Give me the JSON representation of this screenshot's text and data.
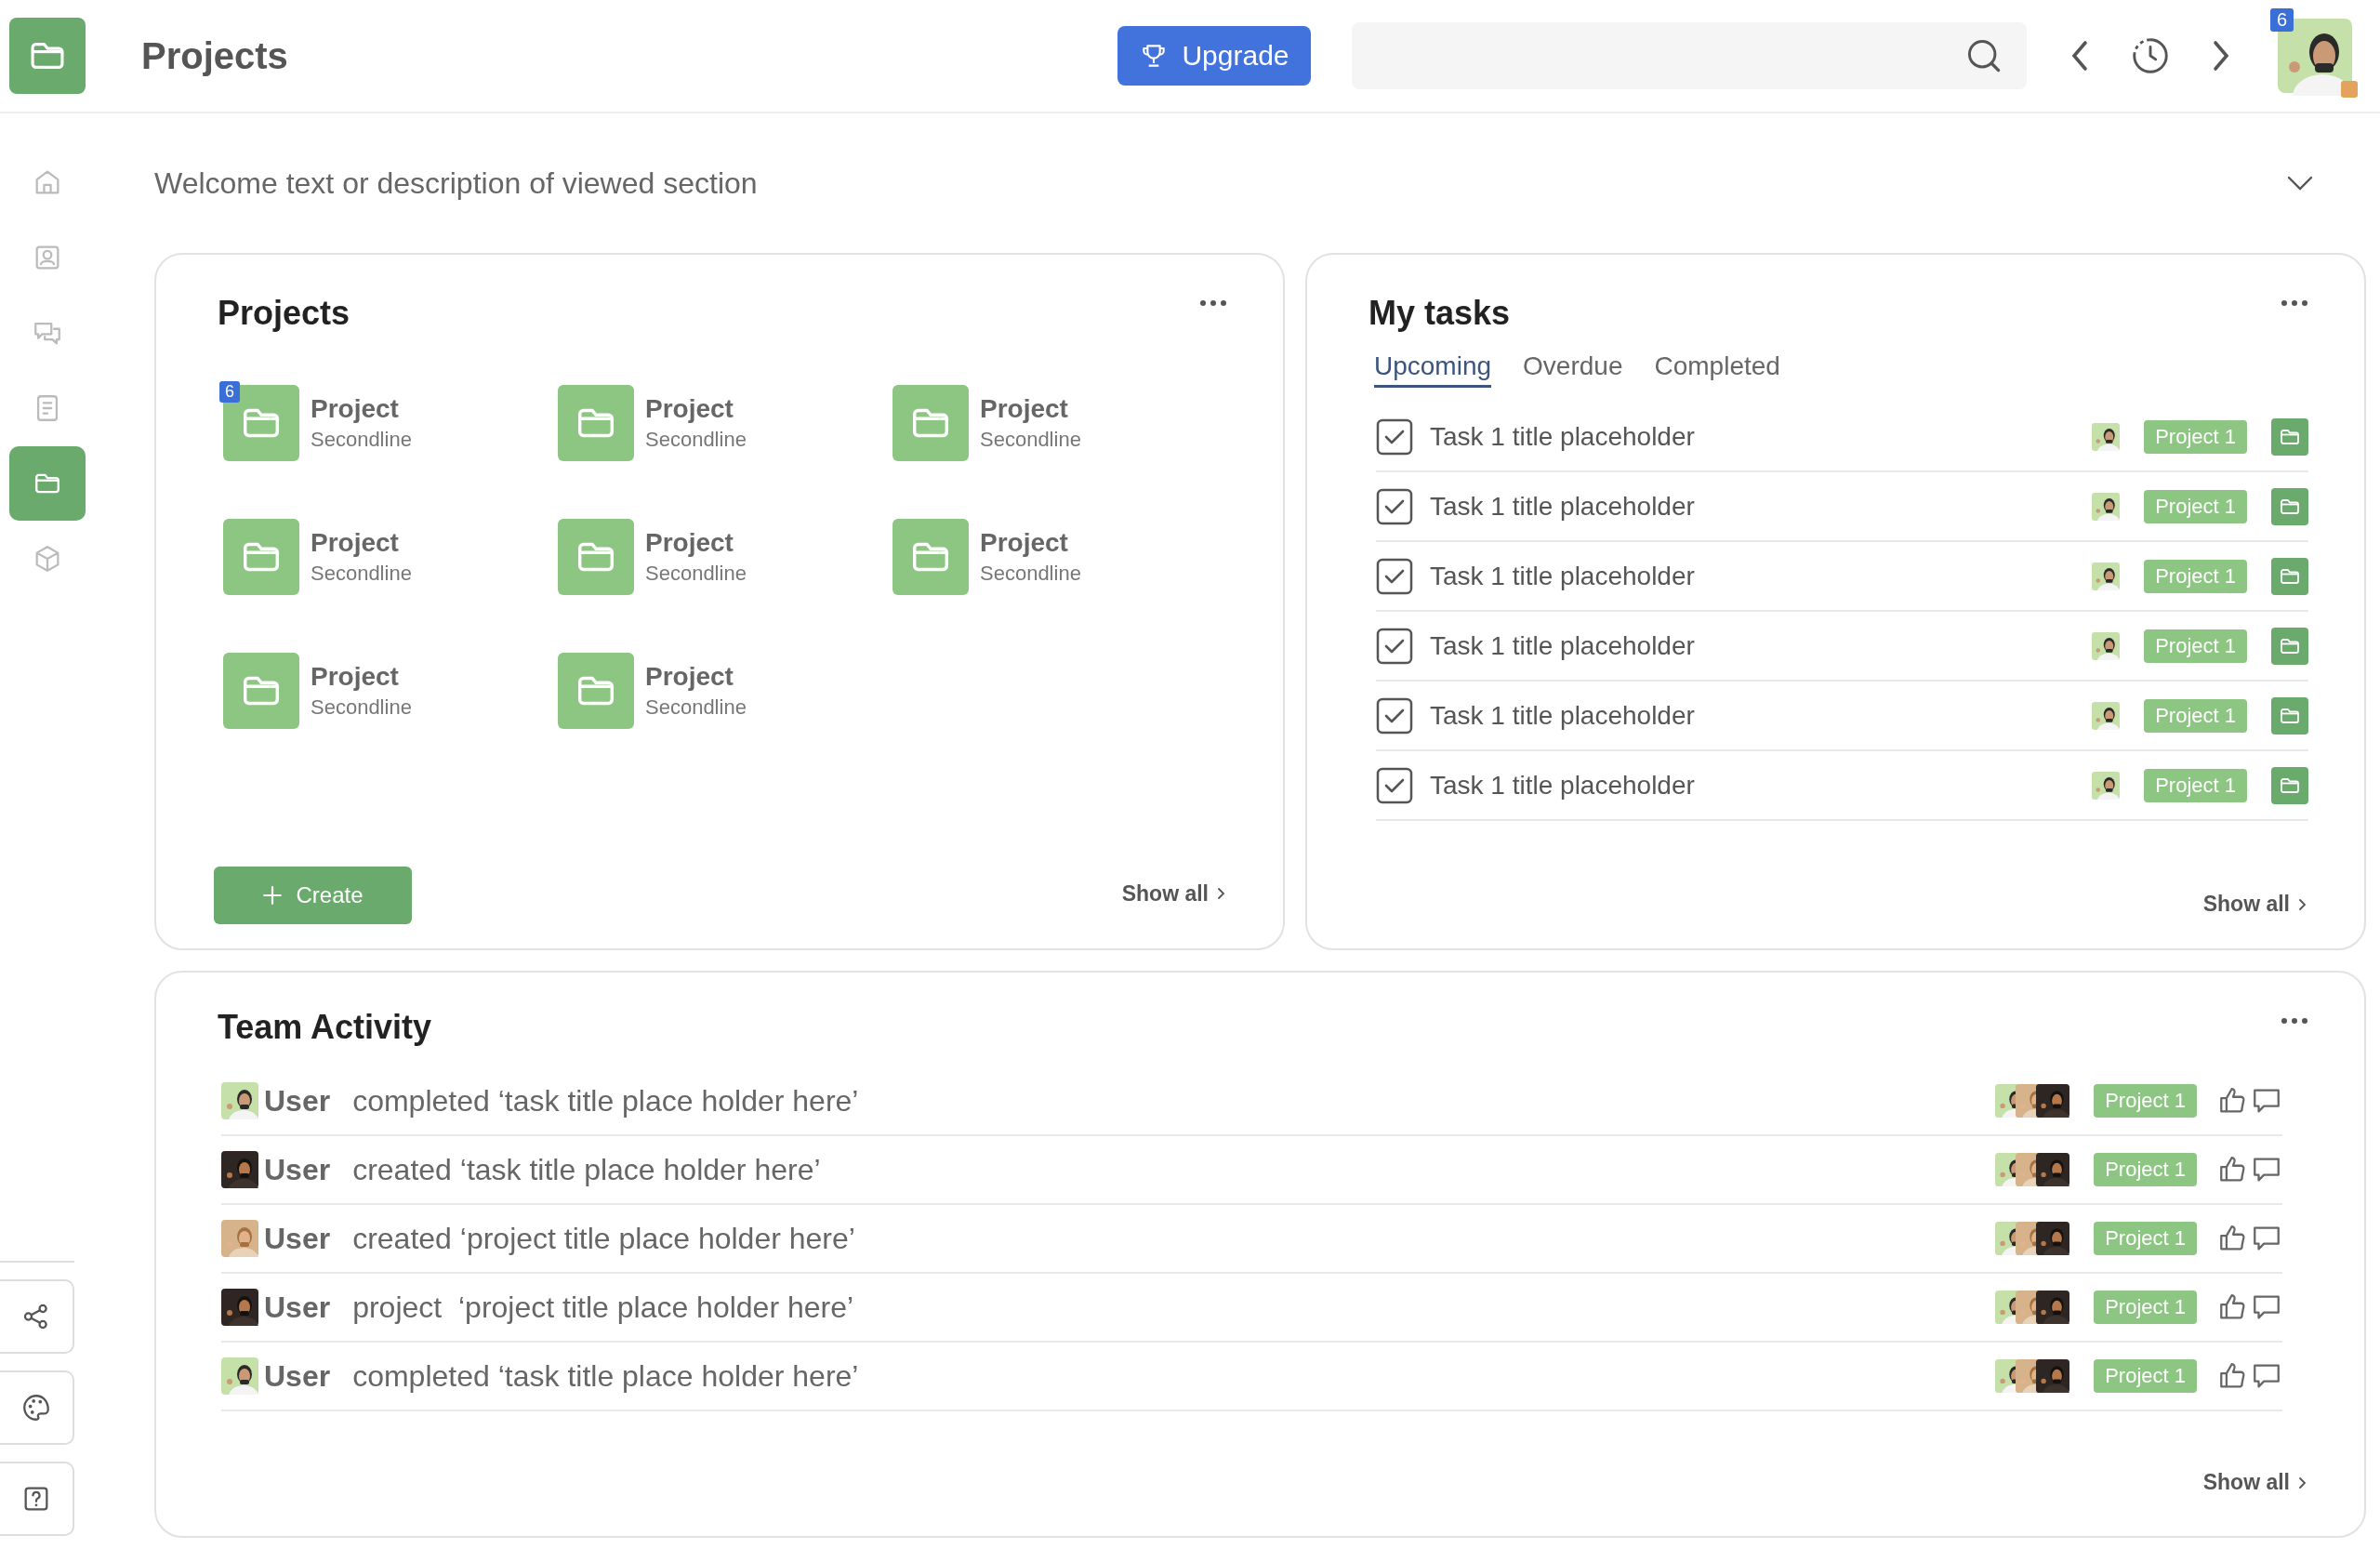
{
  "header": {
    "title": "Projects",
    "upgrade_label": "Upgrade",
    "notification_count": "6"
  },
  "sidebar": {
    "items": [
      {
        "kind": "home",
        "selected": false
      },
      {
        "kind": "contact",
        "selected": false
      },
      {
        "kind": "chat",
        "selected": false
      },
      {
        "kind": "document",
        "selected": false
      },
      {
        "kind": "folder",
        "selected": true
      },
      {
        "kind": "cube",
        "selected": false
      }
    ],
    "tools": [
      {
        "kind": "share"
      },
      {
        "kind": "palette"
      },
      {
        "kind": "help"
      }
    ]
  },
  "welcome": "Welcome text or description of viewed section",
  "projects_card": {
    "title": "Projects",
    "projects": [
      {
        "name": "Project",
        "subtitle": "Secondline",
        "badge": "6"
      },
      {
        "name": "Project",
        "subtitle": "Secondline"
      },
      {
        "name": "Project",
        "subtitle": "Secondline"
      },
      {
        "name": "Project",
        "subtitle": "Secondline"
      },
      {
        "name": "Project",
        "subtitle": "Secondline"
      },
      {
        "name": "Project",
        "subtitle": "Secondline"
      },
      {
        "name": "Project",
        "subtitle": "Secondline"
      },
      {
        "name": "Project",
        "subtitle": "Secondline"
      }
    ],
    "create_label": "Create",
    "show_all": "Show all"
  },
  "tasks_card": {
    "title": "My tasks",
    "tabs": [
      {
        "label": "Upcoming",
        "selected": true
      },
      {
        "label": "Overdue",
        "selected": false
      },
      {
        "label": "Completed",
        "selected": false
      }
    ],
    "tasks": [
      {
        "title": "Task 1 title placeholder",
        "checked": true,
        "project": "Project 1"
      },
      {
        "title": "Task 1 title placeholder",
        "checked": true,
        "project": "Project 1"
      },
      {
        "title": "Task 1 title placeholder",
        "checked": true,
        "project": "Project 1"
      },
      {
        "title": "Task 1 title placeholder",
        "checked": true,
        "project": "Project 1"
      },
      {
        "title": "Task 1 title placeholder",
        "checked": true,
        "project": "Project 1"
      },
      {
        "title": "Task 1 title placeholder",
        "checked": true,
        "project": "Project 1"
      }
    ],
    "show_all": "Show all"
  },
  "activity_card": {
    "title": "Team Activity",
    "items": [
      {
        "user": "User",
        "action": "completed ‘task title place holder here’",
        "project": "Project 1"
      },
      {
        "user": "User",
        "action": "created ‘task title place holder here’",
        "project": "Project 1"
      },
      {
        "user": "User",
        "action": "created ‘project title place holder here’",
        "project": "Project 1"
      },
      {
        "user": "User",
        "action": "project  ‘project title place holder here’",
        "project": "Project 1"
      },
      {
        "user": "User",
        "action": "completed ‘task title place holder here’",
        "project": "Project 1"
      }
    ],
    "show_all": "Show all"
  }
}
